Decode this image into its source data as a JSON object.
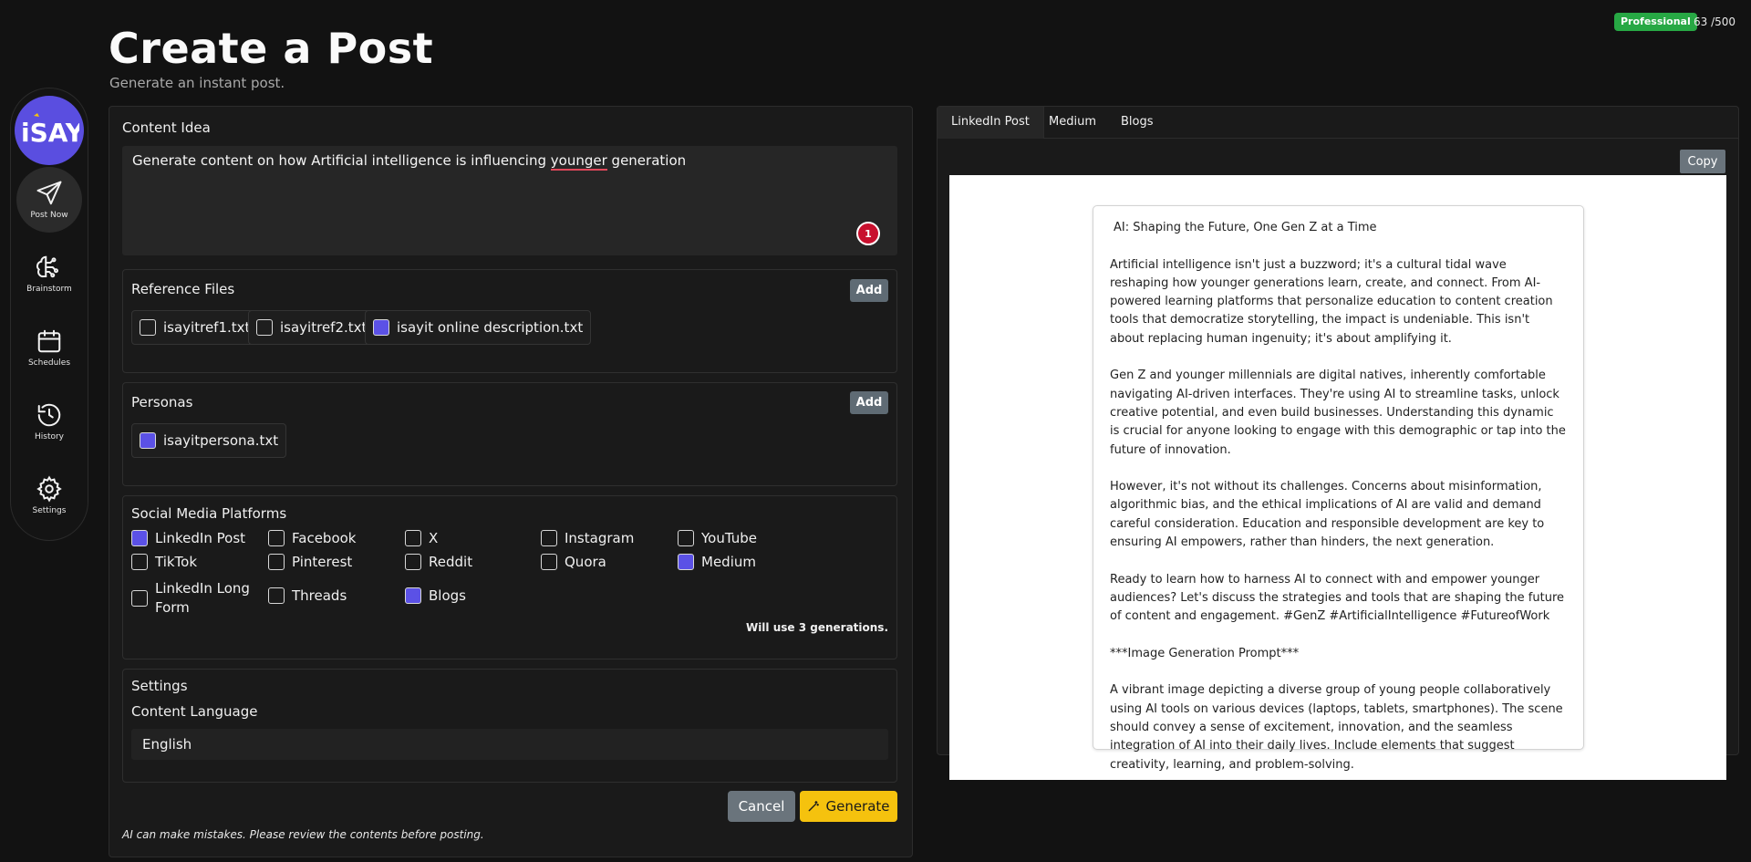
{
  "header": {
    "plan_badge": "Professional",
    "usage": "63 /500",
    "title": "Create a Post",
    "subtitle": "Generate an instant post."
  },
  "sidebar": {
    "items": [
      {
        "label": "Post Now",
        "icon": "send-icon"
      },
      {
        "label": "Brainstorm",
        "icon": "brain-icon"
      },
      {
        "label": "Schedules",
        "icon": "calendar-icon"
      },
      {
        "label": "History",
        "icon": "history-icon"
      },
      {
        "label": "Settings",
        "icon": "gear-icon"
      }
    ]
  },
  "content_idea": {
    "label": "Content Idea",
    "text_before": "Generate content on how Artificial intelligence is influencing ",
    "misspelled": "younger",
    "text_after": " generation",
    "notification_count": "1"
  },
  "reference_files": {
    "label": "Reference Files",
    "add_label": "Add",
    "files": [
      {
        "name": "isayitref1.txt",
        "checked": false
      },
      {
        "name": "isayitref2.txt",
        "checked": false
      },
      {
        "name": "isayit online description.txt",
        "checked": true
      }
    ]
  },
  "personas": {
    "label": "Personas",
    "add_label": "Add",
    "files": [
      {
        "name": "isayitpersona.txt",
        "checked": true
      }
    ]
  },
  "platforms": {
    "label": "Social Media Platforms",
    "items": [
      {
        "name": "LinkedIn Post",
        "checked": true
      },
      {
        "name": "Facebook",
        "checked": false
      },
      {
        "name": "X",
        "checked": false
      },
      {
        "name": "Instagram",
        "checked": false
      },
      {
        "name": "YouTube",
        "checked": false
      },
      {
        "name": "TikTok",
        "checked": false
      },
      {
        "name": "Pinterest",
        "checked": false
      },
      {
        "name": "Reddit",
        "checked": false
      },
      {
        "name": "Quora",
        "checked": false
      },
      {
        "name": "Medium",
        "checked": true
      },
      {
        "name": "LinkedIn Long",
        "name_line2": "Form",
        "checked": false
      },
      {
        "name": "Threads",
        "checked": false
      },
      {
        "name": "Blogs",
        "checked": true
      }
    ],
    "generation_note": "Will use 3 generations."
  },
  "settings": {
    "label": "Settings",
    "language_label": "Content Language",
    "language_value": "English"
  },
  "actions": {
    "cancel_label": "Cancel",
    "generate_label": "Generate",
    "disclaimer": "AI can make mistakes. Please review the contents before posting."
  },
  "output": {
    "tabs": [
      "LinkedIn Post",
      "Medium",
      "Blogs"
    ],
    "active_tab": "LinkedIn Post",
    "copy_label": "Copy",
    "post_title": "AI: Shaping the Future, One Gen Z at a Time",
    "paragraphs": [
      "Artificial intelligence isn't just a buzzword; it's a cultural tidal wave reshaping how younger generations learn, create, and connect. From AI-powered learning platforms that personalize education to content creation tools that democratize storytelling, the impact is undeniable. This isn't about replacing human ingenuity; it's about amplifying it.",
      "Gen Z and younger millennials are digital natives, inherently comfortable navigating AI-driven interfaces. They're using AI to streamline tasks, unlock creative potential, and even build businesses. Understanding this dynamic is crucial for anyone looking to engage with this demographic or tap into the future of innovation.",
      "However, it's not without its challenges. Concerns about misinformation, algorithmic bias, and the ethical implications of AI are valid and demand careful consideration. Education and responsible development are key to ensuring AI empowers, rather than hinders, the next generation.",
      "Ready to learn how to harness AI to connect with and empower younger audiences? Let's discuss the strategies and tools that are shaping the future of content and engagement. #GenZ #ArtificialIntelligence #FutureofWork",
      "***Image Generation Prompt***",
      "A vibrant image depicting a diverse group of young people collaboratively using AI tools on various devices (laptops, tablets, smartphones). The scene should convey a sense of excitement, innovation, and the seamless integration of AI into their daily lives. Include elements that suggest creativity, learning, and problem-solving."
    ]
  },
  "colors": {
    "accent": "#5b51e6",
    "generate": "#f5c20e",
    "badge": "#27a844",
    "button_gray": "#6a747c"
  }
}
